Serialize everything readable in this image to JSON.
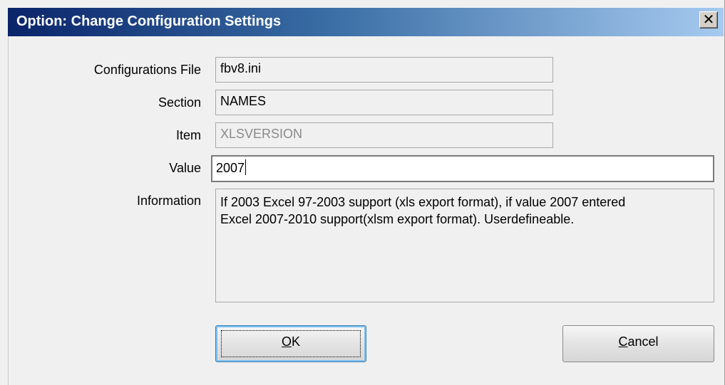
{
  "window": {
    "title": "Option: Change Configuration Settings",
    "close_glyph": "✕"
  },
  "form": {
    "config_file": {
      "label": "Configurations File",
      "value": "fbv8.ini"
    },
    "section": {
      "label": "Section",
      "value": "NAMES"
    },
    "item": {
      "label": "Item",
      "value": "XLSVERSION"
    },
    "value": {
      "label": "Value",
      "value": "2007"
    },
    "information": {
      "label": "Information",
      "line1": "If 2003 Excel 97-2003 support (xls export format), if value 2007 entered",
      "line2": "Excel 2007-2010 support(xlsm export format). Userdefineable."
    }
  },
  "buttons": {
    "ok": {
      "label": "OK",
      "mnemonic": "O",
      "rest": "K"
    },
    "cancel": {
      "label": "Cancel",
      "mnemonic": "C",
      "rest": "ancel"
    }
  }
}
